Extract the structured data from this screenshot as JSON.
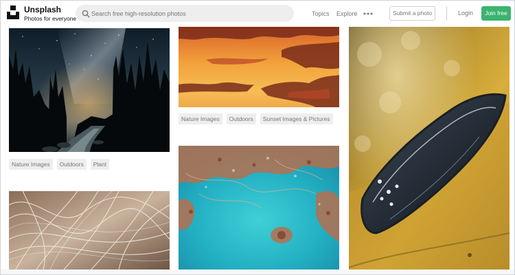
{
  "brand": {
    "name": "Unsplash",
    "tagline": "Photos for everyone"
  },
  "search": {
    "placeholder": "Search free high-resolution photos",
    "value": ""
  },
  "nav": {
    "topics": "Topics",
    "explore": "Explore",
    "more_icon": "ellipsis-icon",
    "submit_label": "Submit a photo",
    "login_label": "Login",
    "join_label": "Join free"
  },
  "colors": {
    "join_button": "#3cb46e",
    "tag_background": "#eeeeee",
    "muted_text": "#767676"
  },
  "photos": [
    {
      "subject": "night sky forest river",
      "tags": [
        "Nature Images",
        "Outdoors",
        "Plant"
      ]
    },
    {
      "subject": "sunset clouds",
      "tags": [
        "Nature Images",
        "Outdoors",
        "Sunset Images & Pictures"
      ]
    },
    {
      "subject": "abstract light strands",
      "tags": []
    },
    {
      "subject": "aerial turquoise water texture",
      "tags": []
    },
    {
      "subject": "yellow car headlight",
      "tags": []
    }
  ]
}
